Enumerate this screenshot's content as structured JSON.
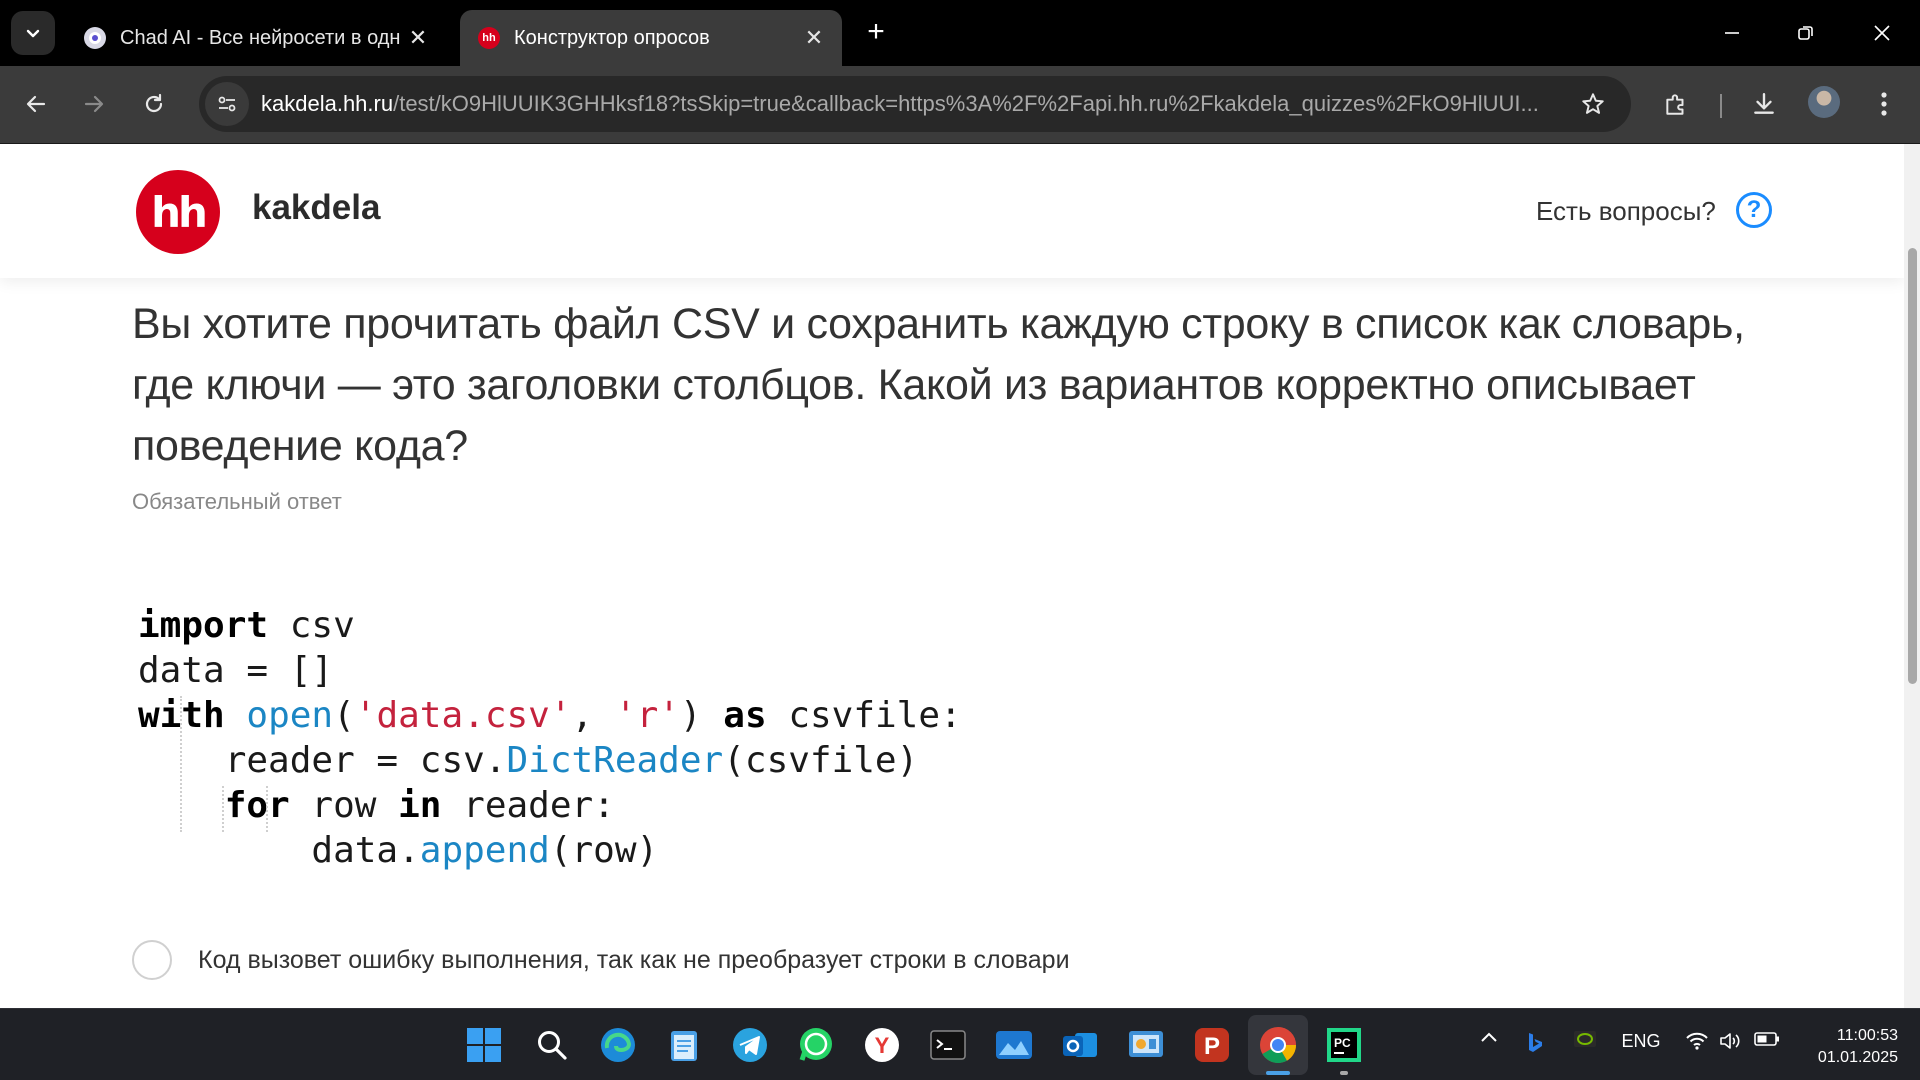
{
  "browser": {
    "tabs": [
      {
        "title": "Chad AI - Все нейросети в одн",
        "favicon": "chad-ai-favicon",
        "active": false
      },
      {
        "title": "Конструктор опросов",
        "favicon": "hh-favicon",
        "active": true
      }
    ],
    "url_host": "kakdela.hh.ru",
    "url_rest": "/test/kO9HlUUIK3GHHksf18?tsSkip=true&callback=https%3A%2F%2Fapi.hh.ru%2Fkakdela_quizzes%2FkO9HlUUI...",
    "favicon_hh_text": "hh"
  },
  "header": {
    "logo_text": "hh",
    "brand": "kakdela",
    "help_text": "Есть вопросы?",
    "help_icon_glyph": "?"
  },
  "question": {
    "text": "Вы хотите прочитать файл CSV и сохранить каждую строку в список как словарь, где ключи — это заголовки столбцов. Какой из вариантов корректно описывает поведение кода?",
    "required_label": "Обязательный ответ"
  },
  "code": {
    "l1_kw": "import",
    "l1_rest": " csv",
    "l2": "data = []",
    "l3_kw": "with",
    "l3_fn": "open",
    "l3_p1": "(",
    "l3_s1": "'data.csv'",
    "l3_c": ", ",
    "l3_s2": "'r'",
    "l3_p2": ") ",
    "l3_kw2": "as",
    "l3_rest": " csvfile:",
    "l4_a": "reader = csv.",
    "l4_fn": "DictReader",
    "l4_b": "(csvfile)",
    "l5_kw": "for",
    "l5_a": " row ",
    "l5_kw2": "in",
    "l5_b": " reader:",
    "l6_a": "data.",
    "l6_fn": "append",
    "l6_b": "(row)"
  },
  "options": [
    {
      "label": "Код вызовет ошибку выполнения, так как не преобразует строки в словари",
      "selected": false
    }
  ],
  "taskbar": {
    "apps": [
      "windows-start",
      "search",
      "edge",
      "notepad",
      "telegram",
      "whatsapp",
      "yandex-browser",
      "terminal",
      "photos",
      "outlook",
      "control-panel",
      "psiphon",
      "chrome",
      "pycharm"
    ],
    "pycharm_text": "PC",
    "yandex_text": "Y",
    "psiphon_text": "P",
    "language": "ENG",
    "time": "11:00:53",
    "date": "01.01.2025"
  },
  "colors": {
    "hh_red": "#d6001c",
    "help_blue": "#1a8cff",
    "code_function": "#1b86c4",
    "code_string": "#c4223d"
  }
}
